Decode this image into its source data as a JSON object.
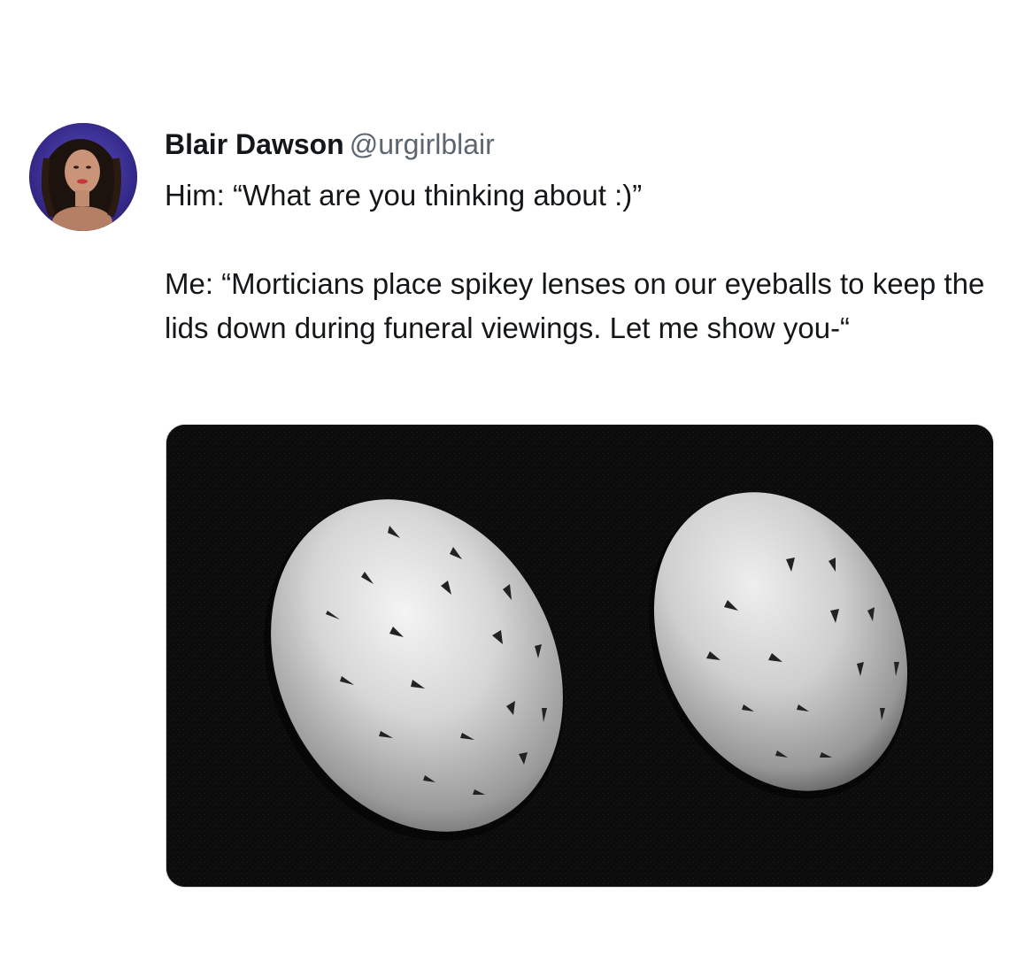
{
  "tweet": {
    "author": {
      "display_name": "Blair Dawson",
      "handle": "@urgirlblair",
      "avatar_icon": "profile-photo"
    },
    "text_line_1": "Him: “What are you thinking about :)”",
    "text_line_2": "Me: “Morticians place spikey lenses on our eyeballs to keep the lids down during funeral viewings. Let me show you-“",
    "media": {
      "kind": "photo",
      "icon": "spiked-eye-caps-photo"
    }
  },
  "colors": {
    "text": "#14171a",
    "handle": "#5b6670",
    "media_bg": "#0b0b0b"
  }
}
